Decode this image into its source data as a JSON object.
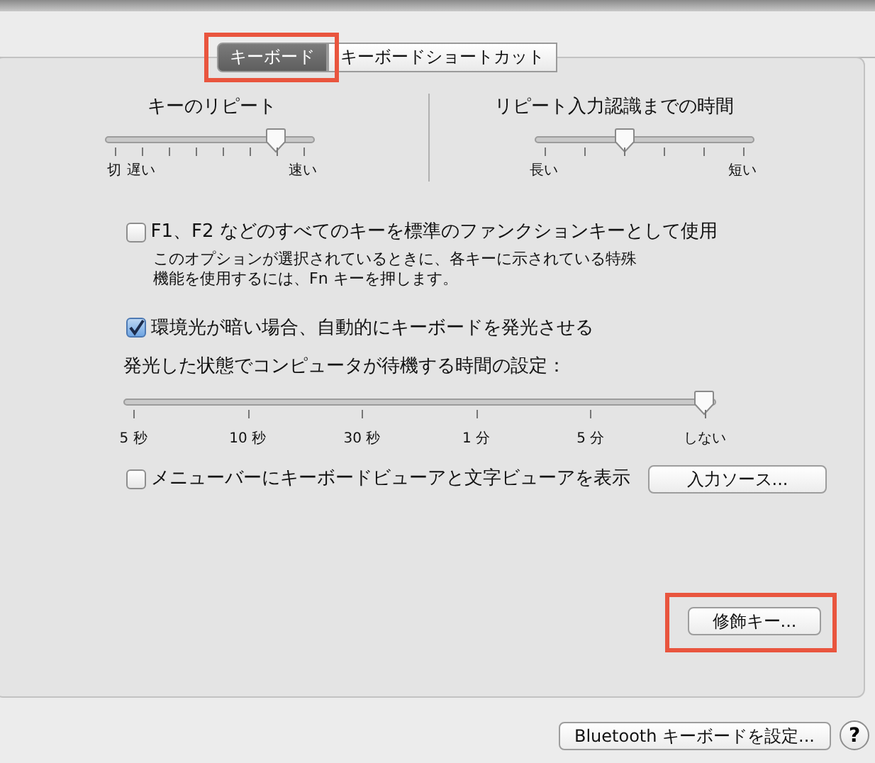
{
  "tabs": [
    {
      "label": "キーボード",
      "selected": true,
      "highlighted": true
    },
    {
      "label": "キーボードショートカット",
      "selected": false
    }
  ],
  "repeat_sliders": [
    {
      "title": "キーのリピート",
      "level": 0.857,
      "ticks": [
        {
          "kind": "labeled",
          "label": "切"
        },
        {
          "kind": "labeled",
          "label": "遅い"
        },
        {
          "kind": "plain"
        },
        {
          "kind": "plain"
        },
        {
          "kind": "plain"
        },
        {
          "kind": "plain"
        },
        {
          "kind": "plain"
        },
        {
          "kind": "labeled",
          "label": "速い"
        }
      ]
    },
    {
      "title": "リピート入力認識までの時間",
      "level": 0.4,
      "ticks": [
        {
          "kind": "labeled",
          "label": "長い"
        },
        {
          "kind": "plain"
        },
        {
          "kind": "plain"
        },
        {
          "kind": "plain"
        },
        {
          "kind": "plain"
        },
        {
          "kind": "labeled",
          "label": "短い"
        }
      ]
    }
  ],
  "fn_option": {
    "label": "F1、F2 などのすべてのキーを標準のファンクションキーとして使用",
    "checked": false,
    "description": [
      "このオプションが選択されているときに、各キーに示されている特殊",
      "機能を使用するには、Fn キーを押します。"
    ]
  },
  "backlight": {
    "label": "環境光が暗い場合、自動的にキーボードを発光させる",
    "checked": true,
    "timeout_label": "発光した状態でコンピュータが待機する時間の設定：",
    "level": 1,
    "ticks": [
      {
        "kind": "labeled",
        "label": "5 秒"
      },
      {
        "kind": "labeled",
        "label": "10 秒"
      },
      {
        "kind": "labeled",
        "label": "30 秒"
      },
      {
        "kind": "labeled",
        "label": "1 分"
      },
      {
        "kind": "labeled",
        "label": "5 分"
      },
      {
        "kind": "labeled",
        "label": "しない"
      }
    ]
  },
  "menu_bar_option": {
    "label": "メニューバーにキーボードビューアと文字ビューアを表示",
    "checked": false
  },
  "input_sources_button": {
    "label": "入力ソース..."
  },
  "modifier_keys_button": {
    "label": "修飾キー...",
    "highlighted": true
  },
  "bluetooth_button": {
    "label": "Bluetooth キーボードを設定..."
  },
  "help_button": {
    "label": "?"
  }
}
